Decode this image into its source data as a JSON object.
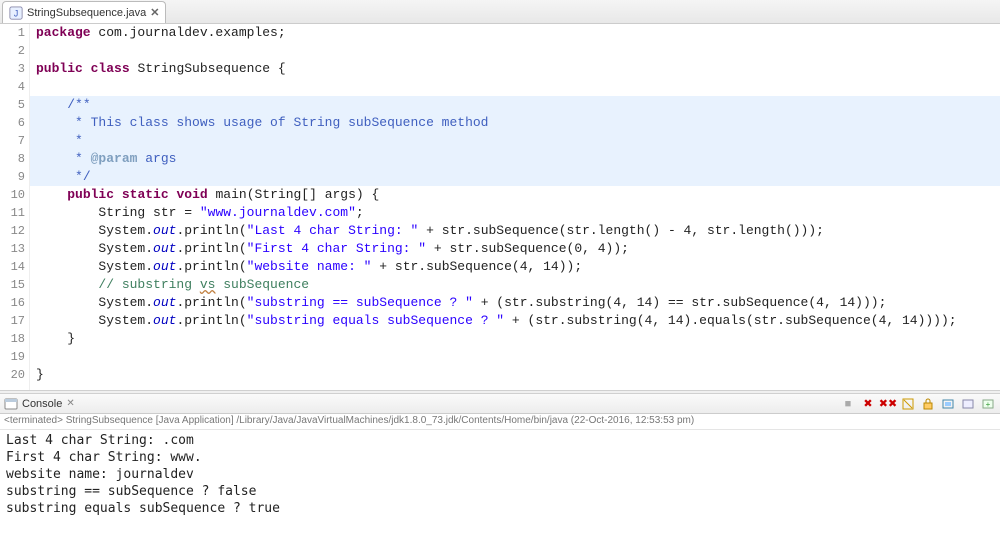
{
  "tab": {
    "filename": "StringSubsequence.java"
  },
  "gutter": [
    "1",
    "2",
    "3",
    "4",
    "5",
    "6",
    "7",
    "8",
    "9",
    "10",
    "11",
    "12",
    "13",
    "14",
    "15",
    "16",
    "17",
    "18",
    "19",
    "20"
  ],
  "code": {
    "l1": {
      "kw1": "package",
      "rest": " com.journaldev.examples;"
    },
    "l3": {
      "kw1": "public",
      "kw2": "class",
      "name": " StringSubsequence {"
    },
    "l5": "/**",
    "l6": " * This class shows usage of String subSequence method",
    "l7": " *",
    "l8_pre": " * ",
    "l8_tag": "@param",
    "l8_post": " args",
    "l9": " */",
    "l10": {
      "kw1": "public",
      "kw2": "static",
      "kw3": "void",
      "rest": " main(String[] args) {"
    },
    "l11": {
      "pre": "String str = ",
      "str": "\"www.journaldev.com\"",
      "post": ";"
    },
    "l12": {
      "pre": "System.",
      "out": "out",
      "mid": ".println(",
      "str": "\"Last 4 char String: \"",
      "post": " + str.subSequence(str.length() - 4, str.length()));"
    },
    "l13": {
      "pre": "System.",
      "out": "out",
      "mid": ".println(",
      "str": "\"First 4 char String: \"",
      "post": " + str.subSequence(0, 4));"
    },
    "l14": {
      "pre": "System.",
      "out": "out",
      "mid": ".println(",
      "str": "\"website name: \"",
      "post": " + str.subSequence(4, 14));"
    },
    "l15_cmt": "// substring ",
    "l15_u": "vs",
    "l15_cmt2": " subSequence",
    "l16": {
      "pre": "System.",
      "out": "out",
      "mid": ".println(",
      "str": "\"substring == subSequence ? \"",
      "post": " + (str.substring(4, 14) == str.subSequence(4, 14)));"
    },
    "l17": {
      "pre": "System.",
      "out": "out",
      "mid": ".println(",
      "str": "\"substring equals subSequence ? \"",
      "post": " + (str.substring(4, 14).equals(str.subSequence(4, 14))));"
    },
    "l18": "    }",
    "l20": "}"
  },
  "console": {
    "tab": "Console",
    "status": "<terminated> StringSubsequence [Java Application] /Library/Java/JavaVirtualMachines/jdk1.8.0_73.jdk/Contents/Home/bin/java (22-Oct-2016, 12:53:53 pm)",
    "output": [
      "Last 4 char String: .com",
      "First 4 char String: www.",
      "website name: journaldev",
      "substring == subSequence ? false",
      "substring equals subSequence ? true"
    ]
  }
}
